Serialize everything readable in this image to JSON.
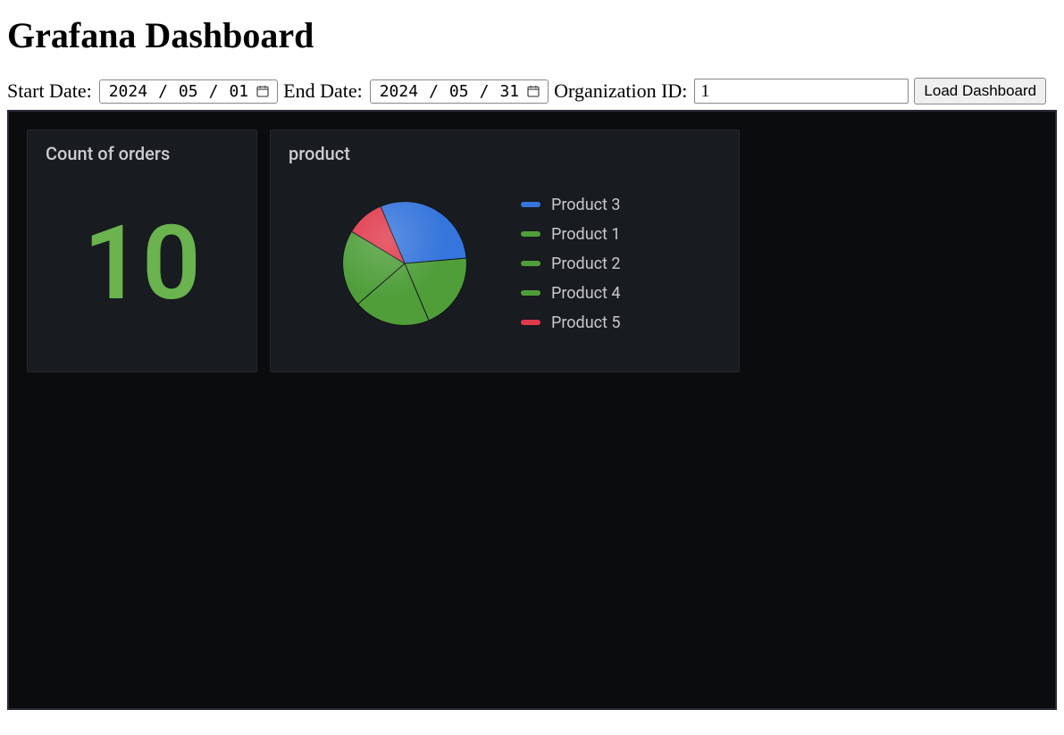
{
  "header": {
    "title": "Grafana Dashboard"
  },
  "controls": {
    "start_date_label": "Start Date:",
    "start_date": {
      "year": "2024",
      "month": "05",
      "day": "01"
    },
    "end_date_label": "End Date:",
    "end_date": {
      "year": "2024",
      "month": "05",
      "day": "31"
    },
    "org_id_label": "Organization ID:",
    "org_id_value": "1",
    "load_button": "Load Dashboard"
  },
  "panels": {
    "count": {
      "title": "Count of orders",
      "value": "10",
      "value_color": "#6ab34f"
    },
    "product": {
      "title": "product"
    }
  },
  "colors": {
    "blue": "#3575dc",
    "green": "#4f9e3a",
    "red": "#e0394a",
    "panel_bg": "#181b1f",
    "dashboard_bg": "#0b0c0e"
  },
  "chart_data": {
    "type": "pie",
    "title": "product",
    "series": [
      {
        "name": "Product 3",
        "value": 3,
        "color": "#3575dc"
      },
      {
        "name": "Product 1",
        "value": 2,
        "color": "#4f9e3a"
      },
      {
        "name": "Product 2",
        "value": 2,
        "color": "#4f9e3a"
      },
      {
        "name": "Product 4",
        "value": 2,
        "color": "#4f9e3a"
      },
      {
        "name": "Product 5",
        "value": 1,
        "color": "#e0394a"
      }
    ]
  }
}
